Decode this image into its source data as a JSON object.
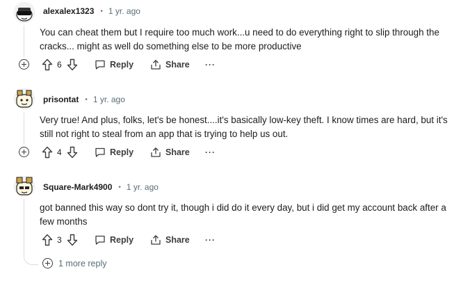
{
  "comments": [
    {
      "author": "alexalex1323",
      "separator": "•",
      "time": "1 yr. ago",
      "body": "You can cheat them but I require too much work...u need to do everything right to slip through the cracks... might as well do something else to be more productive",
      "score": "6",
      "reply_label": "Reply",
      "share_label": "Share",
      "more_label": "···"
    },
    {
      "author": "prisontat",
      "separator": "•",
      "time": "1 yr. ago",
      "body": "Very true! And plus, folks, let's be honest....it's basically low-key theft. I know times are hard, but it's still not right to steal from an app that is trying to help us out.",
      "score": "4",
      "reply_label": "Reply",
      "share_label": "Share",
      "more_label": "···"
    },
    {
      "author": "Square-Mark4900",
      "separator": "•",
      "time": "1 yr. ago",
      "body": "got banned this way so dont try it, though i did do it every day, but i did get my account back after a few months",
      "score": "3",
      "reply_label": "Reply",
      "share_label": "Share",
      "more_label": "···"
    }
  ],
  "more_replies_label": "1 more reply",
  "icons": {
    "collapse": "plus-circle-icon",
    "upvote": "arrow-up-icon",
    "downvote": "arrow-down-icon",
    "reply": "speech-bubble-icon",
    "share": "share-upload-icon",
    "overflow": "ellipsis-icon",
    "avatar": "snoo-avatar-icon"
  },
  "colors": {
    "text": "#1c1c1c",
    "muted": "#576f76",
    "icon": "#3c3c3c",
    "rail": "#d9dcde"
  }
}
